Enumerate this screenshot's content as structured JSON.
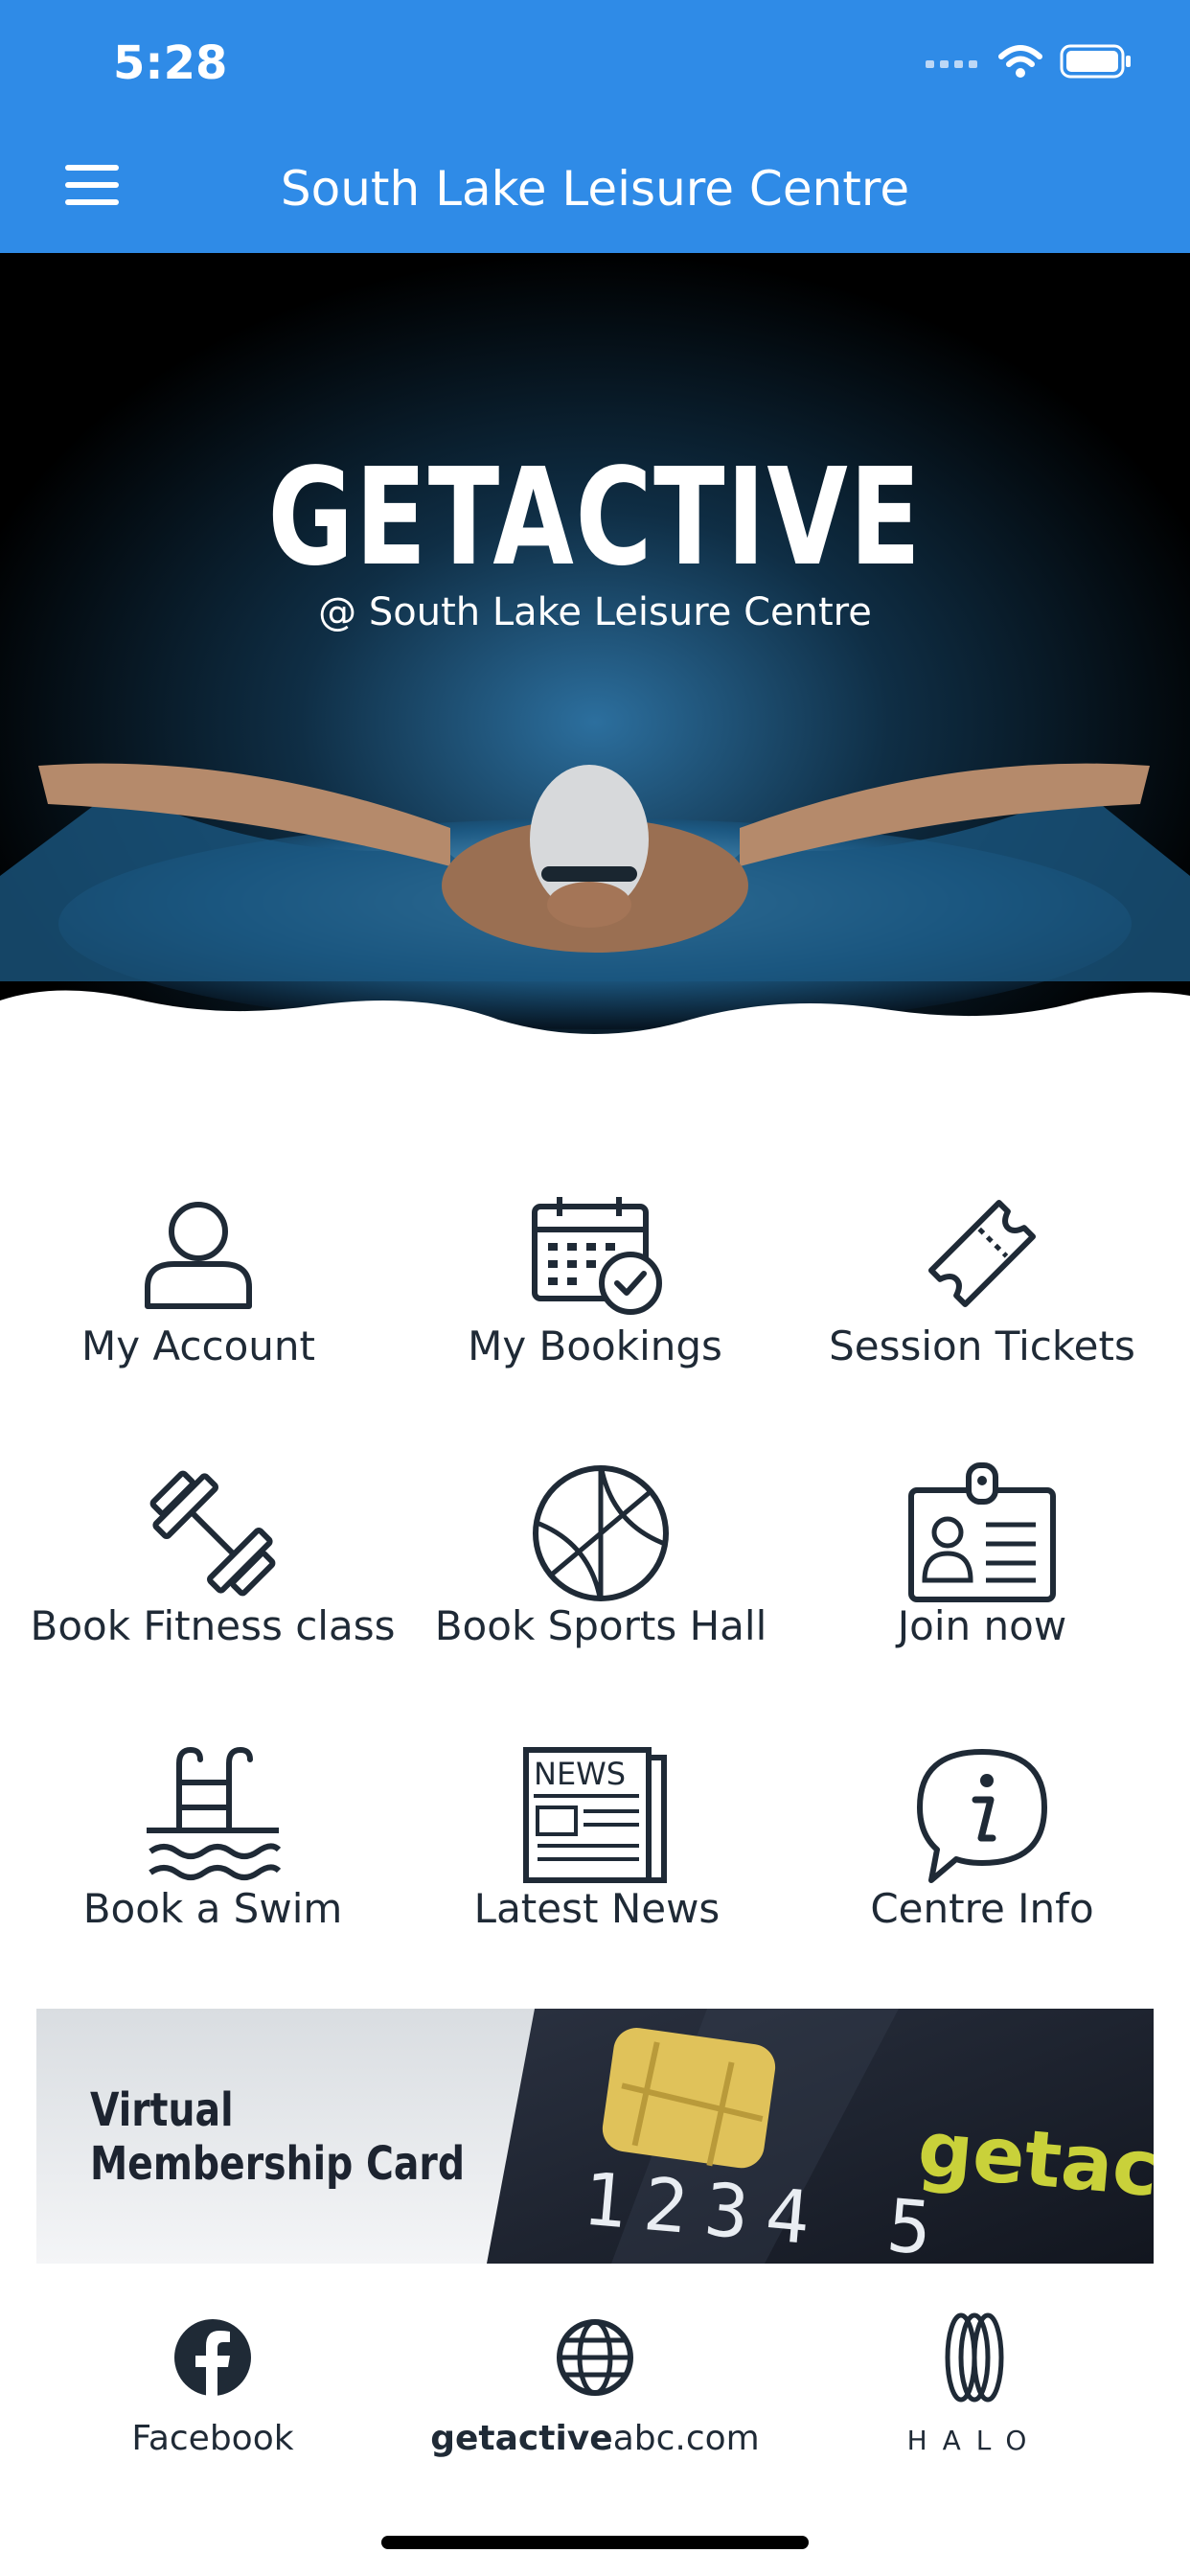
{
  "status_bar": {
    "time": "5:28"
  },
  "app_bar": {
    "title": "South Lake Leisure Centre",
    "menu_icon": "hamburger-menu-icon"
  },
  "hero": {
    "title": "GETACTIVE",
    "subtitle": "@ South Lake Leisure Centre"
  },
  "tiles": [
    {
      "label": "My Account",
      "icon": "user-icon"
    },
    {
      "label": "My Bookings",
      "icon": "calendar-check-icon"
    },
    {
      "label": "Session Tickets",
      "icon": "ticket-icon"
    },
    {
      "label": "Book Fitness class",
      "icon": "dumbbell-icon"
    },
    {
      "label": "Book Sports Hall",
      "icon": "basketball-icon"
    },
    {
      "label": "Join now",
      "icon": "id-badge-icon"
    },
    {
      "label": "Book a Swim",
      "icon": "pool-ladder-icon"
    },
    {
      "label": "Latest News",
      "icon": "newspaper-icon"
    },
    {
      "label": "Centre Info",
      "icon": "info-bubble-icon"
    }
  ],
  "banner": {
    "title_line1": "Virtual",
    "title_line2": "Membership Card",
    "card_number": "1234 5",
    "card_brand": "getact"
  },
  "footer": [
    {
      "label": "Facebook",
      "icon": "facebook-icon"
    },
    {
      "label_bold": "getactive",
      "label_rest": "abc.com",
      "icon": "globe-icon"
    },
    {
      "label": "HALO",
      "icon": "halo-logo-icon"
    }
  ],
  "colors": {
    "primary": "#2f8be7",
    "text": "#1f2a36",
    "accent_card": "#c9d13a"
  }
}
